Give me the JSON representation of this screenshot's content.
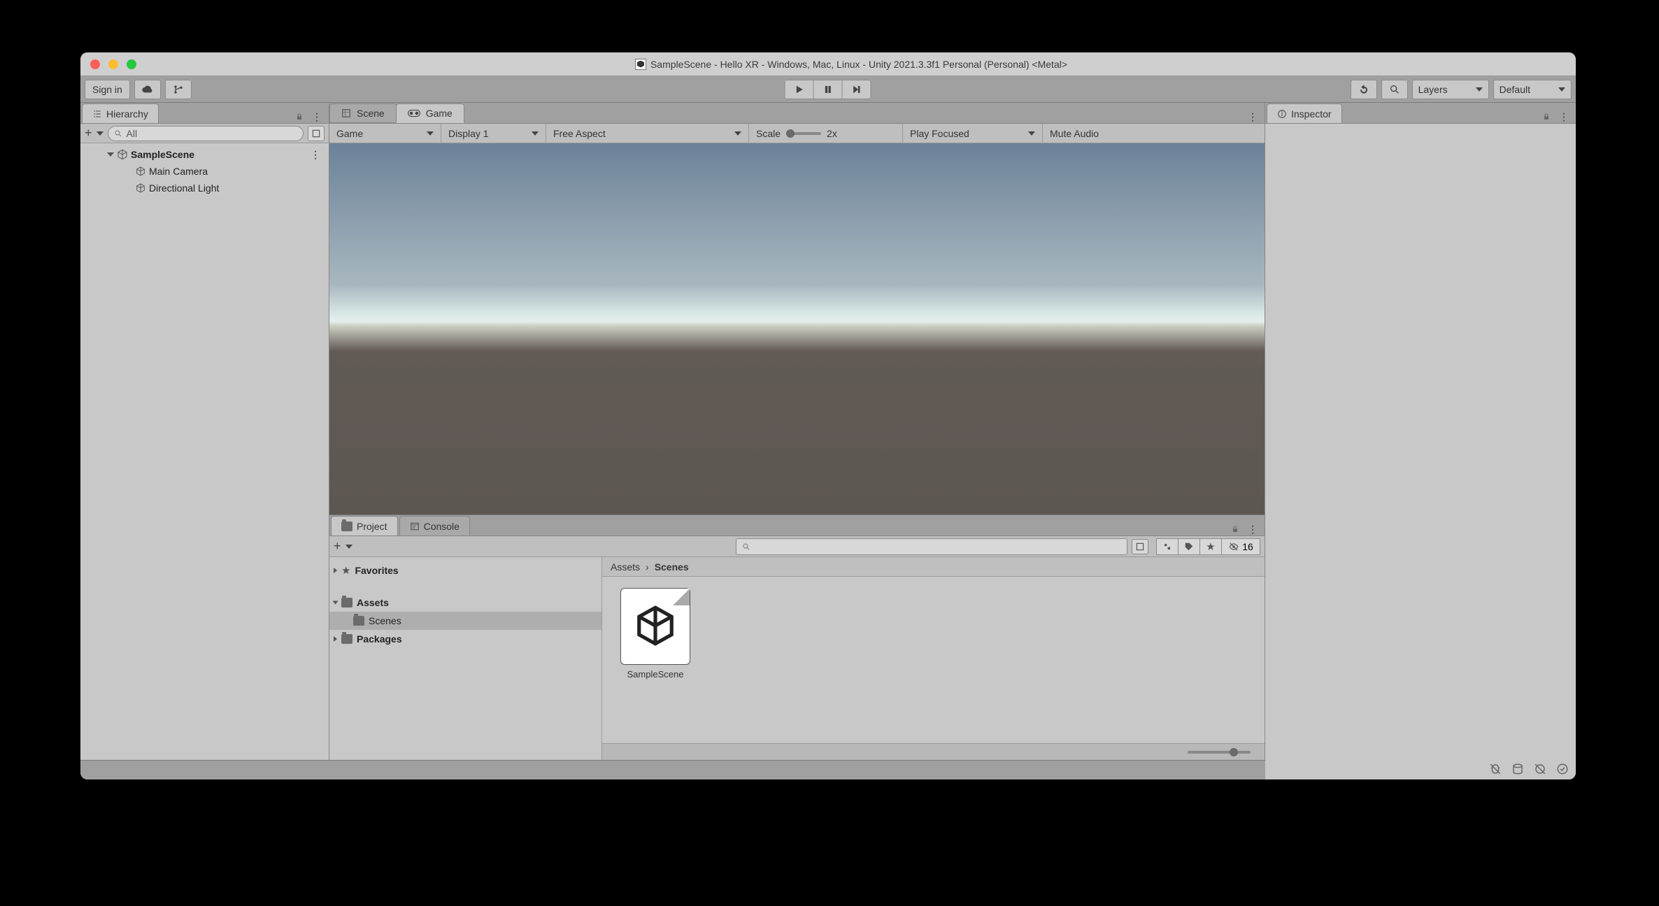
{
  "window": {
    "title": "SampleScene - Hello XR - Windows, Mac, Linux - Unity 2021.3.3f1 Personal (Personal) <Metal>"
  },
  "toolbar": {
    "signin": "Sign in",
    "layers": "Layers",
    "layout": "Default"
  },
  "hierarchy": {
    "tab": "Hierarchy",
    "search": "All",
    "scene": "SampleScene",
    "items": [
      "Main Camera",
      "Directional Light"
    ]
  },
  "scene_tab": "Scene",
  "game_tab": "Game",
  "game_toolbar": {
    "mode": "Game",
    "display": "Display 1",
    "aspect": "Free Aspect",
    "scale_label": "Scale",
    "scale_value": "2x",
    "focus": "Play Focused",
    "mute": "Mute Audio"
  },
  "project": {
    "tab_project": "Project",
    "tab_console": "Console",
    "favorites": "Favorites",
    "assets": "Assets",
    "scenes": "Scenes",
    "packages": "Packages",
    "breadcrumb_root": "Assets",
    "breadcrumb_leaf": "Scenes",
    "asset_name": "SampleScene",
    "hidden_count": "16"
  },
  "inspector": {
    "tab": "Inspector"
  }
}
